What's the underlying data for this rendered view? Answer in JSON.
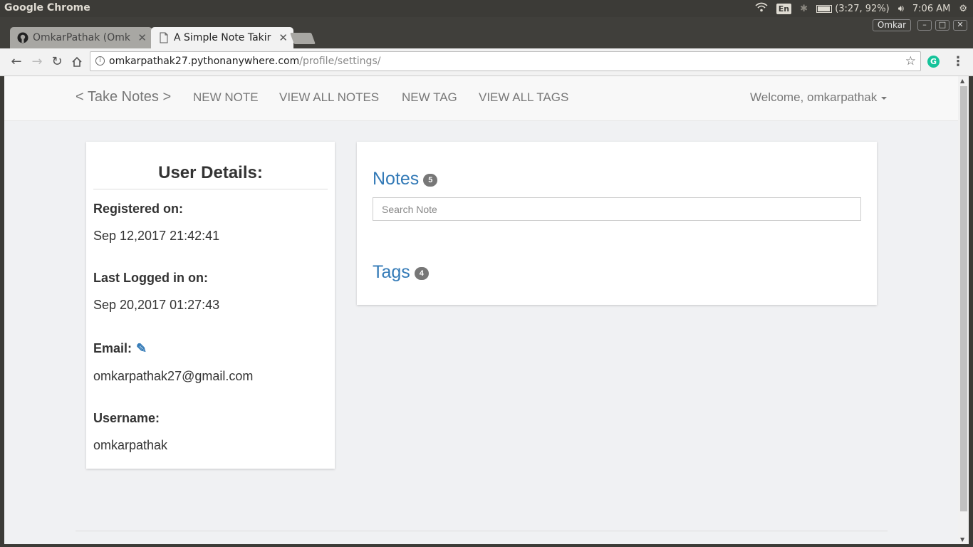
{
  "os": {
    "app_name": "Google Chrome",
    "lang": "En",
    "battery": "(3:27, 92%)",
    "time": "7:06 AM"
  },
  "browser": {
    "tabs": [
      {
        "title": "OmkarPathak (Omk",
        "active": false
      },
      {
        "title": "A Simple Note Takir",
        "active": true
      }
    ],
    "profile": "Omkar",
    "url_host": "omkarpathak27.pythonanywhere.com",
    "url_path": "/profile/settings/"
  },
  "navbar": {
    "brand": "< Take Notes >",
    "links": [
      "NEW NOTE",
      "VIEW ALL NOTES",
      "NEW TAG",
      "VIEW ALL TAGS"
    ],
    "welcome": "Welcome, omkarpathak"
  },
  "user_details": {
    "title": "User Details:",
    "registered_label": "Registered on:",
    "registered_value": "Sep 12,2017 21:42:41",
    "last_logged_label": "Last Logged in on:",
    "last_logged_value": "Sep 20,2017 01:27:43",
    "email_label": "Email:",
    "email_value": "omkarpathak27@gmail.com",
    "username_label": "Username:",
    "username_value": "omkarpathak"
  },
  "main": {
    "notes_title": "Notes",
    "notes_count": "5",
    "search_placeholder": "Search Note",
    "tags_title": "Tags",
    "tags_count": "4"
  },
  "colors": {
    "link": "#337ab7",
    "badge": "#777777",
    "page_bg": "#f0f1f3"
  }
}
